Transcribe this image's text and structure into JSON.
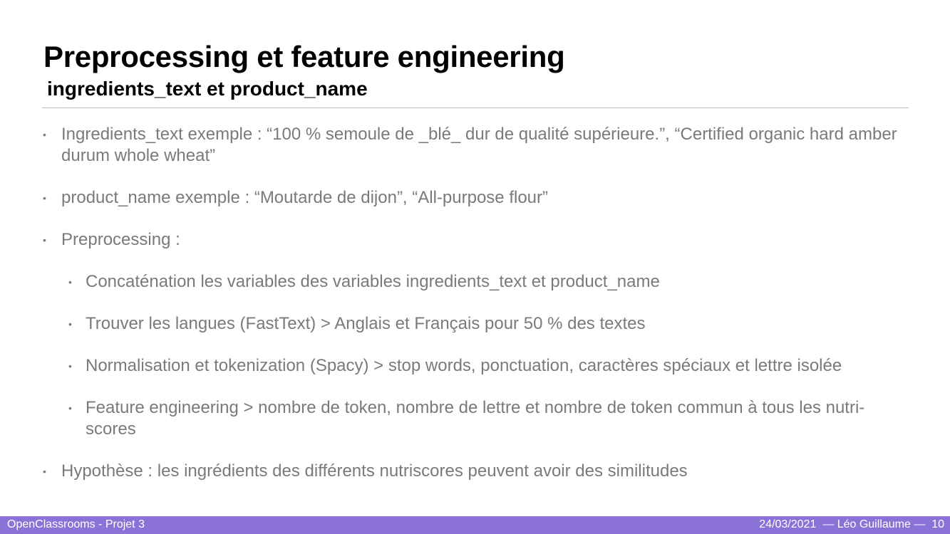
{
  "slide": {
    "title": "Preprocessing et feature engineering",
    "subtitle": "ingredients_text et product_name",
    "bullet_glyph": "•",
    "bullets": [
      "Ingredients_text exemple : “100 % semoule de _blé_ dur de qualité supérieure.”, “Certified organic hard amber durum whole wheat”",
      "product_name exemple : “Moutarde de dijon”, “All-purpose flour”",
      "Preprocessing :",
      "Concaténation les variables des variables ingredients_text et product_name",
      "Trouver les langues (FastText) > Anglais et Français pour 50 % des textes",
      "Normalisation et tokenization (Spacy) > stop words, ponctuation, caractères spéciaux et lettre isolée",
      "Feature engineering > nombre de token, nombre de lettre et nombre de token commun à tous les nutri-scores",
      "Hypothèse : les ingrédients des différents nutriscores peuvent avoir des similitudes"
    ]
  },
  "footer": {
    "left": "OpenClassrooms - Projet 3",
    "date": "24/03/2021",
    "author": "Léo Guillaume",
    "separator": "—",
    "page_number": "10",
    "background_color": "#8a72d6"
  },
  "colors": {
    "title": "#000000",
    "body_text": "#7a7a7a",
    "rule": "#bdbdbd"
  }
}
